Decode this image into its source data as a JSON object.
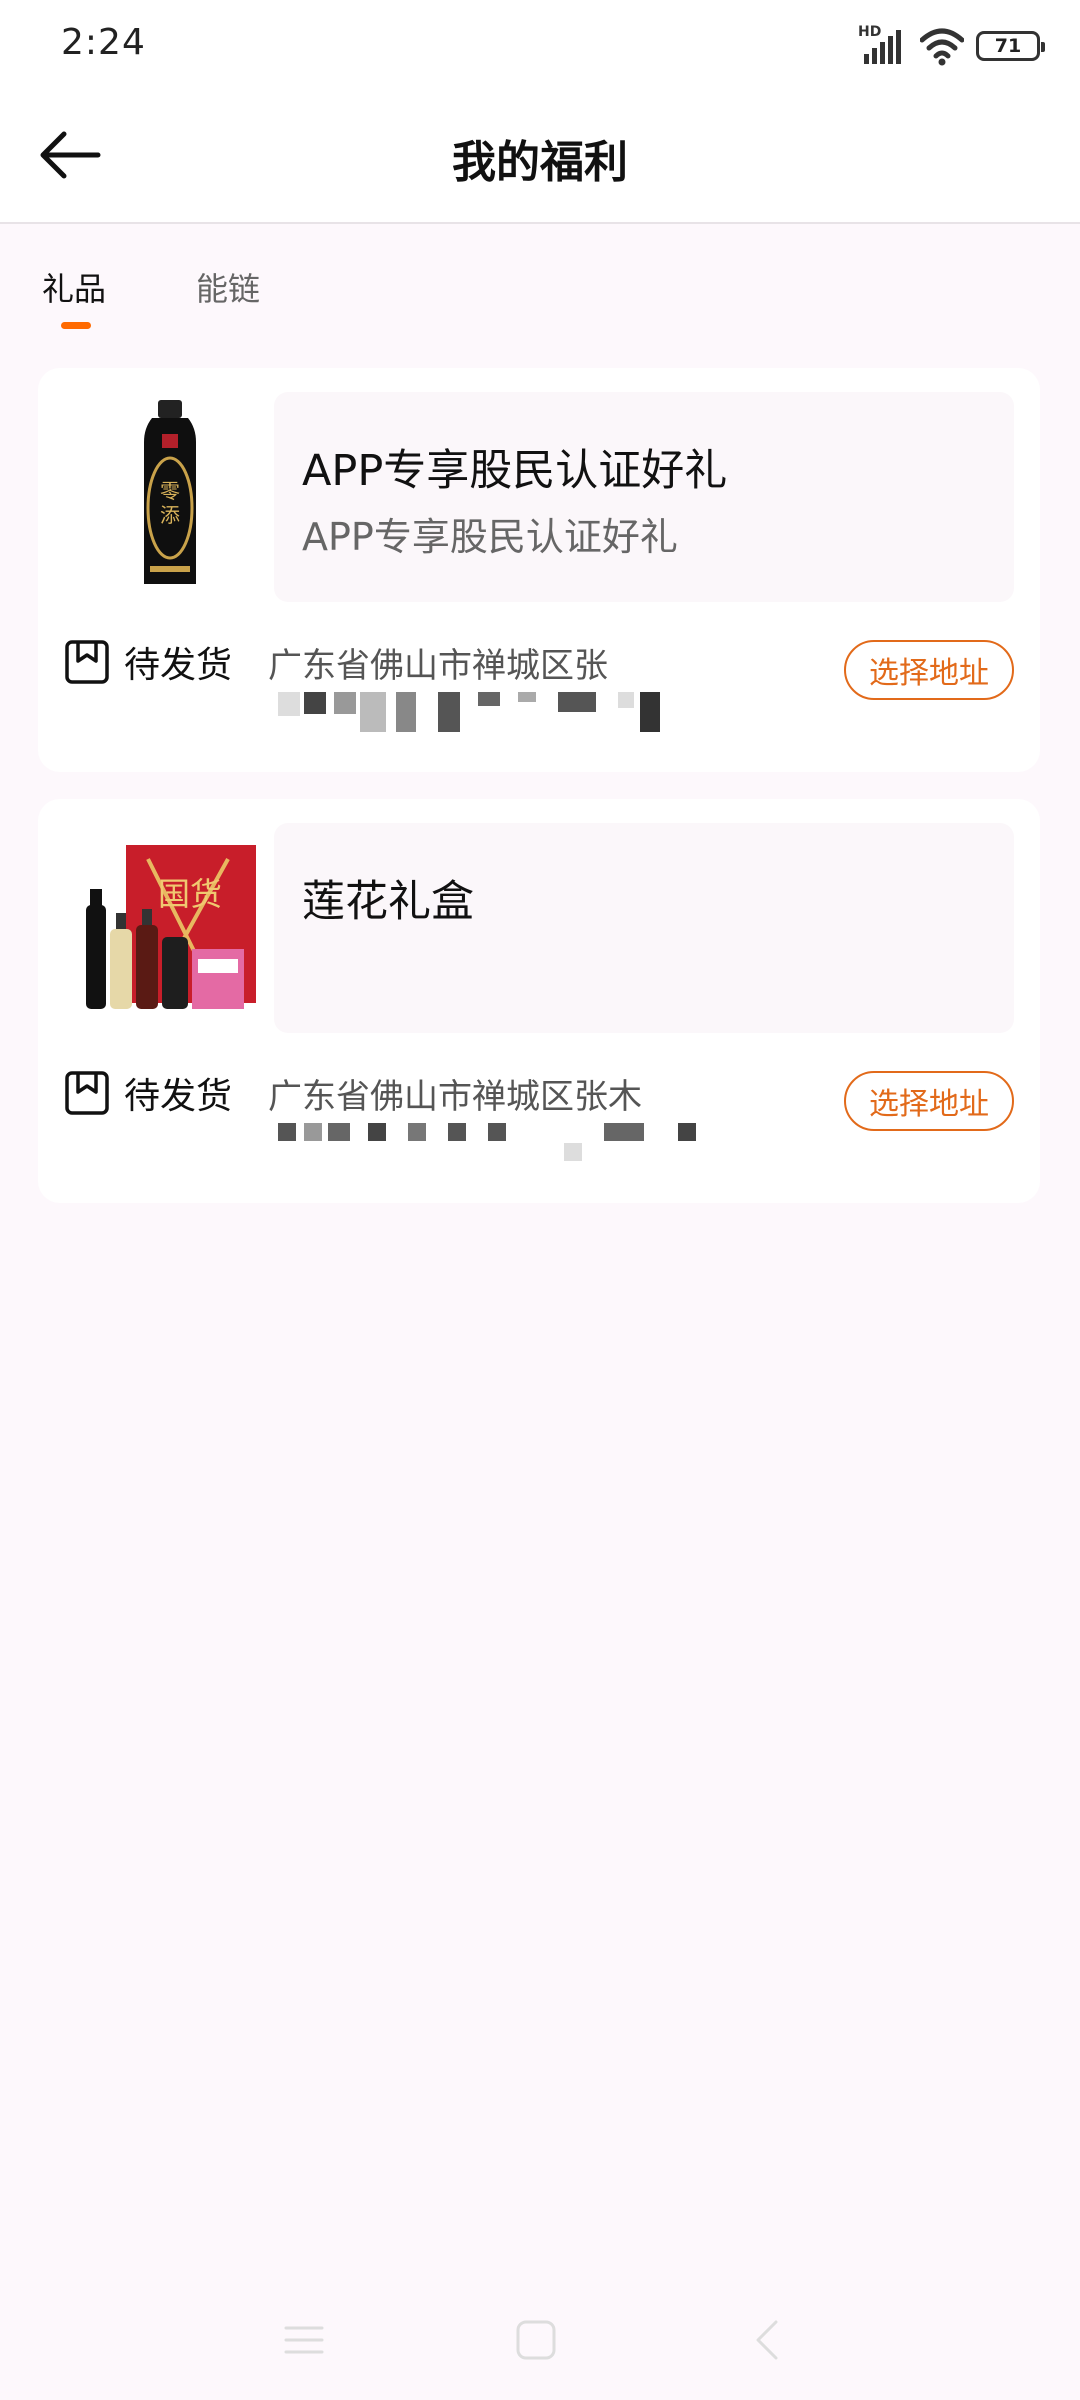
{
  "status_bar": {
    "time": "2:24",
    "battery_level": "71",
    "network_label": "HD"
  },
  "header": {
    "title": "我的福利"
  },
  "tabs": [
    {
      "label": "礼品",
      "active": true
    },
    {
      "label": "能链",
      "active": false
    }
  ],
  "gifts": [
    {
      "title": "APP专享股民认证好礼",
      "subtitle": "APP专享股民认证好礼",
      "status": "待发货",
      "address": "广东省佛山市禅城区张",
      "button_label": "选择地址",
      "thumbnail_icon": "soy-sauce-bottle-image"
    },
    {
      "title": "莲花礼盒",
      "subtitle": "",
      "status": "待发货",
      "address": "广东省佛山市禅城区张木",
      "button_label": "选择地址",
      "thumbnail_icon": "gift-box-image"
    }
  ],
  "colors": {
    "accent": "#ff6a00",
    "button": "#e26a1a",
    "background": "#fdf8fc"
  }
}
